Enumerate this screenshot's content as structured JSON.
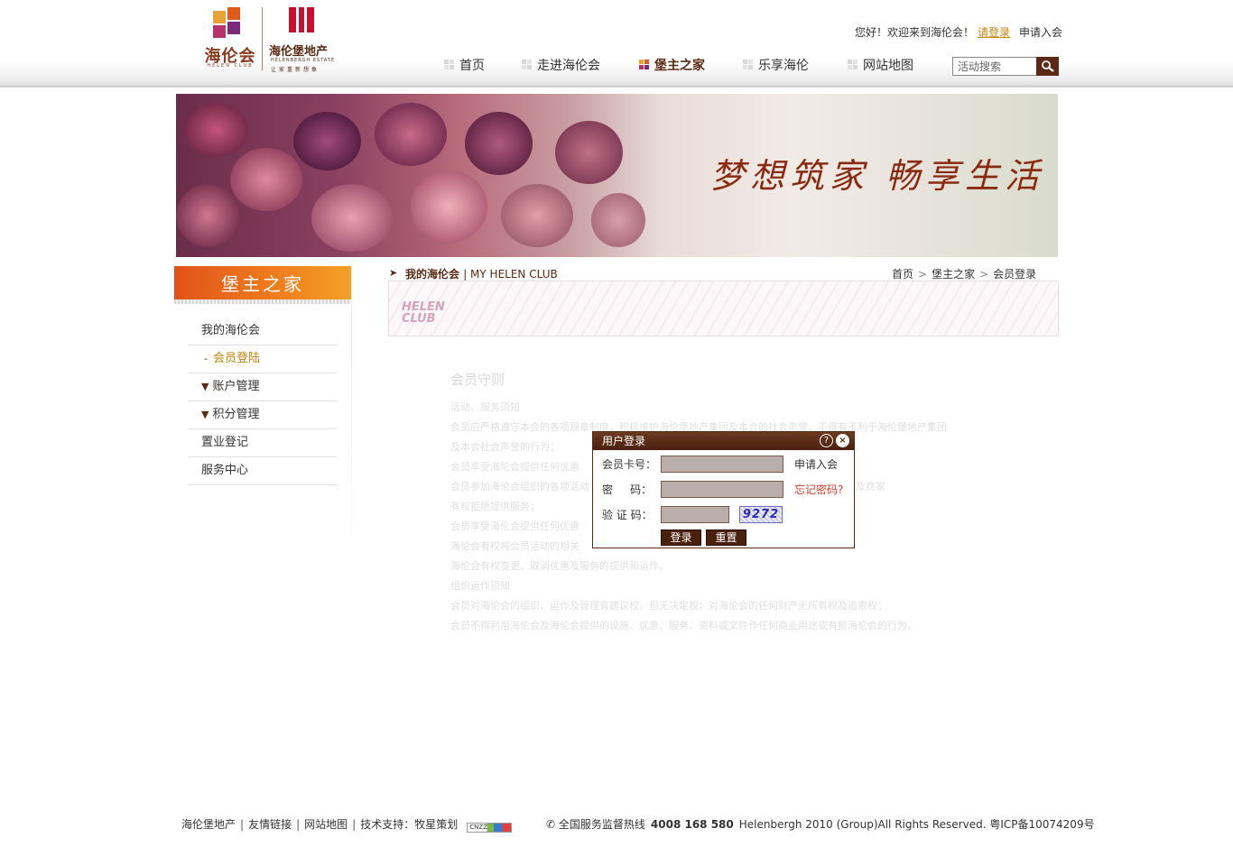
{
  "header": {
    "logo_helen": "海伦会",
    "logo_helen_sub": "HELEN CLUB",
    "logo_estate": "海伦堡地产",
    "logo_estate_sub": "HELENBERGH ESTATE",
    "logo_estate_slogan": "让家重新想象",
    "welcome_text": "您好！欢迎来到海伦会！",
    "login_link": "请登录",
    "apply_link": "申请入会",
    "search_value": "活动搜索"
  },
  "nav": {
    "items": [
      {
        "label": "首页"
      },
      {
        "label": "走进海伦会"
      },
      {
        "label": "堡主之家"
      },
      {
        "label": "乐享海伦"
      },
      {
        "label": "网站地图"
      }
    ],
    "active_index": 2
  },
  "banner": {
    "slogan": "梦想筑家  畅享生活"
  },
  "sidebar": {
    "title": "堡主之家",
    "items": [
      {
        "label": "我的海伦会"
      },
      {
        "label": "会员登陆",
        "prefix": "-"
      },
      {
        "label": "账户管理",
        "prefix": "▼"
      },
      {
        "label": "积分管理",
        "prefix": "▼"
      },
      {
        "label": "置业登记"
      },
      {
        "label": "服务中心"
      }
    ]
  },
  "content": {
    "section_title": "我的海伦会",
    "section_title_en": "| MY HELEN CLUB",
    "breadcrumb": [
      "首页",
      "堡主之家",
      "会员登录"
    ],
    "club_logo_line1": "HELEN",
    "club_logo_line2": "CLUB"
  },
  "rules": {
    "title": "会员守则",
    "lines": [
      "活动、服务须知",
      "会员应严格遵守本会的各项规章制度，积极维护海伦堡地产集团及本会的社会声誉，不得有不利于海伦堡地产集团",
      "及本会社会声誉的行为；",
      "会员享受海伦会提供任何优惠",
      "会员参加海伦会组织的各项活动                                                        会员卡，否则海伦会及商家",
      "有权拒绝提供服务；",
      "会员享受海伦会提供任何优惠",
      "海伦会有权将会员活动的相关",
      "海伦会有权变更、取消优惠及服务的提供和运作。",
      "组织运作须知",
      "会员对海伦会的组织、运作及管理有建议权，但无决定权；对海伦会的任何财产无所有权及追索权；",
      "会员不得利用海伦会及海伦会提供的设施、优惠、服务、资料或文件作任何商业用途或有损海伦会的行为。"
    ]
  },
  "login_dialog": {
    "title": "用户登录",
    "card_label": "会员卡号：",
    "password_label": "密     码：",
    "captcha_label": "验 证 码：",
    "apply_link": "申请入会",
    "forgot_link": "忘记密码?",
    "captcha_value": "9272",
    "submit_label": "登录",
    "reset_label": "重置"
  },
  "footer": {
    "links": [
      "海伦堡地产",
      "友情链接",
      "网站地图",
      "技术支持：牧星策划"
    ],
    "cnzz": "CNZZ",
    "hotline_label": "全国服务监督热线",
    "hotline": "4008 168 580",
    "copyright": "Helenbergh 2010 (Group)All Rights Reserved. 粤ICP备10074209号"
  },
  "colors": {
    "brand_brown": "#5a2a14",
    "accent_orange": "#f07f1e",
    "link_gold": "#c8850c",
    "forgot_red": "#d0402a"
  }
}
